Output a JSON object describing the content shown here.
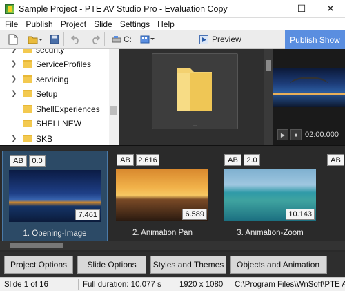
{
  "window": {
    "title": "Sample Project - PTE AV Studio Pro - Evaluation Copy"
  },
  "menu": [
    "File",
    "Publish",
    "Project",
    "Slide",
    "Settings",
    "Help"
  ],
  "toolbar": {
    "drive_label": "C:",
    "preview_label": "Preview",
    "publish_label": "Publish Show"
  },
  "tree": {
    "items": [
      {
        "label": "security",
        "has_arrow": true
      },
      {
        "label": "ServiceProfiles",
        "has_arrow": true
      },
      {
        "label": "servicing",
        "has_arrow": true
      },
      {
        "label": "Setup",
        "has_arrow": true
      },
      {
        "label": "ShellExperiences",
        "has_arrow": false
      },
      {
        "label": "SHELLNEW",
        "has_arrow": false
      },
      {
        "label": "SKB",
        "has_arrow": true
      }
    ]
  },
  "files": {
    "parent_label": ".."
  },
  "player": {
    "time": "02:00.000"
  },
  "slides": [
    {
      "transition": "AB",
      "transition_time": "0.0",
      "duration": "7.461",
      "label": "1. Opening-Image",
      "selected": true
    },
    {
      "transition": "AB",
      "transition_time": "2.616",
      "duration": "6.589",
      "label": "2. Animation Pan",
      "selected": false
    },
    {
      "transition": "AB",
      "transition_time": "2.0",
      "duration": "10.143",
      "label": "3. Animation-Zoom",
      "selected": false
    },
    {
      "transition": "AB",
      "transition_time": "",
      "duration": "",
      "label": "",
      "selected": false
    }
  ],
  "bottom_buttons": [
    "Project Options",
    "Slide Options",
    "Styles and Themes",
    "Objects and Animation"
  ],
  "status": {
    "slide": "Slide 1 of 16",
    "duration": "Full duration: 10.077 s",
    "resolution": "1920 x 1080",
    "path": "C:\\Program Files\\WnSoft\\PTE AV"
  },
  "colors": {
    "publish": "#5a8ee0",
    "selected_slide": "#2c4a66"
  }
}
